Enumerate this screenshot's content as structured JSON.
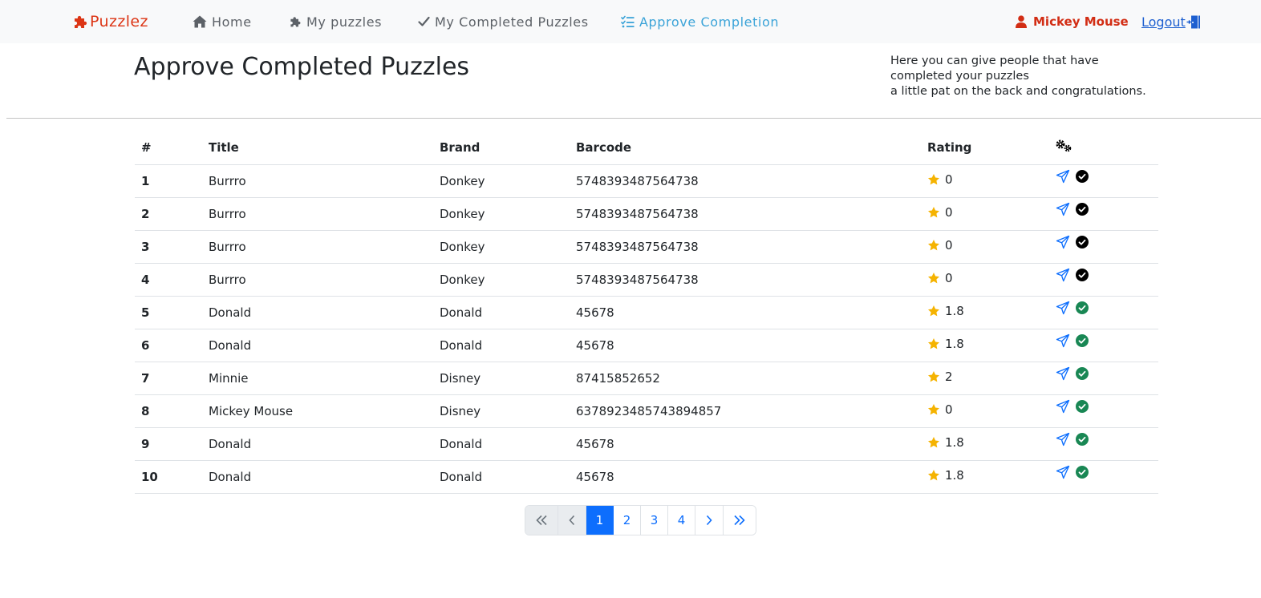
{
  "navbar": {
    "brand": "Puzzlez",
    "links": [
      {
        "label": "Home",
        "icon": "home-icon"
      },
      {
        "label": "My puzzles",
        "icon": "puzzle-piece-icon"
      },
      {
        "label": "My Completed Puzzles",
        "icon": "check-icon"
      },
      {
        "label": "Approve Completion",
        "icon": "list-check-icon",
        "active": true
      }
    ],
    "user": "Mickey Mouse",
    "logout": "Logout"
  },
  "header": {
    "title": "Approve Completed Puzzles",
    "intro_lines": [
      "Here you can give people that have",
      "completed your puzzles",
      "a little pat on the back and congratulations."
    ]
  },
  "table": {
    "columns": [
      "#",
      "Title",
      "Brand",
      "Barcode",
      "Rating"
    ],
    "actions_header_icon": "gears-icon",
    "rows": [
      {
        "num": "1",
        "title": "Burrro",
        "brand": "Donkey",
        "barcode": "5748393487564738",
        "rating": "0",
        "approved": false
      },
      {
        "num": "2",
        "title": "Burrro",
        "brand": "Donkey",
        "barcode": "5748393487564738",
        "rating": "0",
        "approved": false
      },
      {
        "num": "3",
        "title": "Burrro",
        "brand": "Donkey",
        "barcode": "5748393487564738",
        "rating": "0",
        "approved": false
      },
      {
        "num": "4",
        "title": "Burrro",
        "brand": "Donkey",
        "barcode": "5748393487564738",
        "rating": "0",
        "approved": false
      },
      {
        "num": "5",
        "title": "Donald",
        "brand": "Donald",
        "barcode": "45678",
        "rating": "1.8",
        "approved": true
      },
      {
        "num": "6",
        "title": "Donald",
        "brand": "Donald",
        "barcode": "45678",
        "rating": "1.8",
        "approved": true
      },
      {
        "num": "7",
        "title": "Minnie",
        "brand": "Disney",
        "barcode": "87415852652",
        "rating": "2",
        "approved": true
      },
      {
        "num": "8",
        "title": "Mickey Mouse",
        "brand": "Disney",
        "barcode": "6378923485743894857",
        "rating": "0",
        "approved": true
      },
      {
        "num": "9",
        "title": "Donald",
        "brand": "Donald",
        "barcode": "45678",
        "rating": "1.8",
        "approved": true
      },
      {
        "num": "10",
        "title": "Donald",
        "brand": "Donald",
        "barcode": "45678",
        "rating": "1.8",
        "approved": true
      }
    ]
  },
  "pagination": {
    "pages": [
      "1",
      "2",
      "3",
      "4"
    ],
    "current": "1"
  },
  "colors": {
    "brand": "#dc3515",
    "nav_active": "#3aa3d8",
    "user": "#d22d14",
    "star": "#f5b301",
    "approved_check": "#198754",
    "unapproved_check": "#000000",
    "send_icon": "#0d6efd",
    "page_active": "#0d6efd"
  }
}
